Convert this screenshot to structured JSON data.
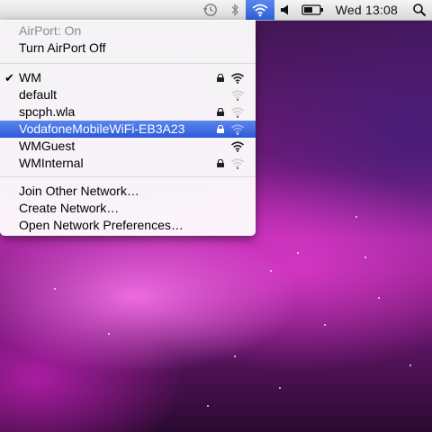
{
  "menubar": {
    "time_label": "Wed 13:08",
    "icons": [
      "time-machine-icon",
      "bluetooth-icon",
      "wifi-icon",
      "volume-icon",
      "battery-icon",
      "spotlight-icon"
    ]
  },
  "airport_menu": {
    "status_label": "AirPort: On",
    "toggle_label": "Turn AirPort Off",
    "networks": [
      {
        "name": "WM",
        "checked": true,
        "locked": true,
        "signal": 3
      },
      {
        "name": "default",
        "checked": false,
        "locked": false,
        "signal": 1
      },
      {
        "name": "spcph.wla",
        "checked": false,
        "locked": true,
        "signal": 1
      },
      {
        "name": "VodafoneMobileWiFi-EB3A23",
        "checked": false,
        "locked": true,
        "signal": 1,
        "highlighted": true
      },
      {
        "name": "WMGuest",
        "checked": false,
        "locked": false,
        "signal": 3
      },
      {
        "name": "WMInternal",
        "checked": false,
        "locked": true,
        "signal": 1
      }
    ],
    "actions": [
      "Join Other Network…",
      "Create Network…",
      "Open Network Preferences…"
    ]
  },
  "colors": {
    "highlight": "#3a67de",
    "menubar": "#e8e8e8"
  }
}
